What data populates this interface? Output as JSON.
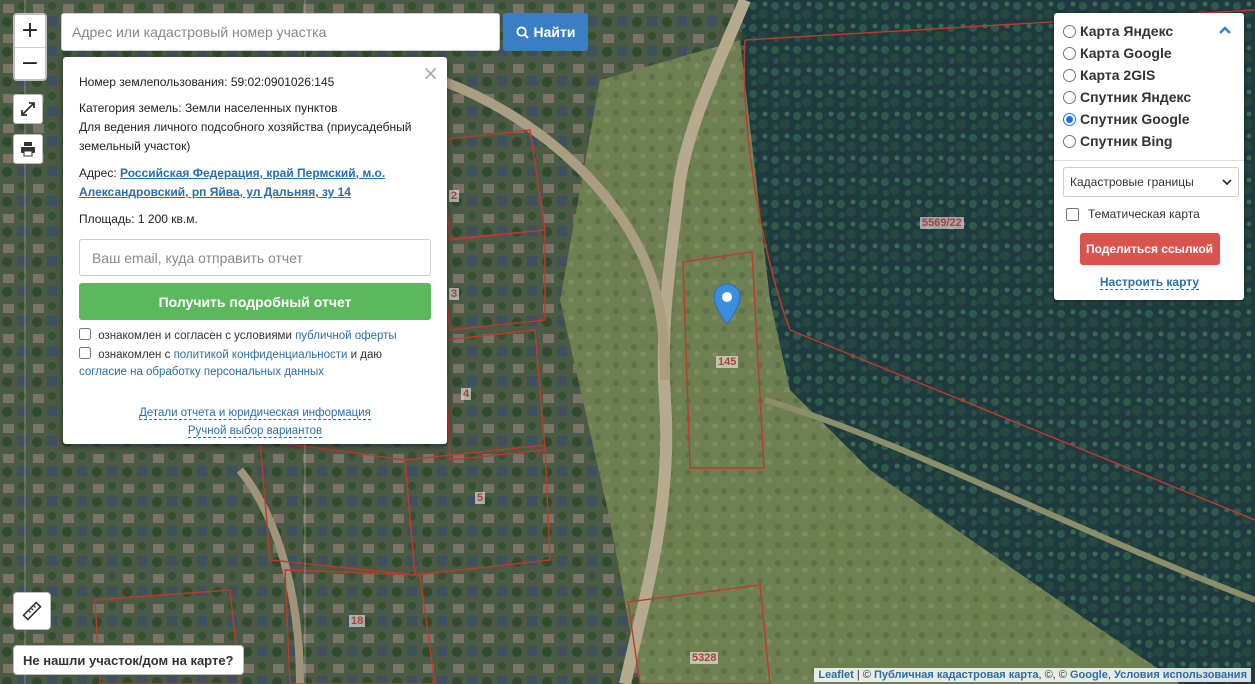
{
  "search": {
    "placeholder": "Адрес или кадастровый номер участка",
    "button_label": "Найти"
  },
  "zoom": {
    "in_label": "+",
    "out_label": "−"
  },
  "popup": {
    "land_use_label": "Номер землепользования:",
    "land_use_number": "59:02:0901026:145",
    "category_label": "Категория земель:",
    "category_value": "Земли населенных пунктов",
    "purpose": "Для ведения личного подсобного хозяйства (приусадебный земельный участок)",
    "address_label": "Адрес:",
    "address_value": "Российская Федерация, край Пермский, м.о. Александровский, рп Яйва, ул Дальняя, зу 14",
    "area_label": "Площадь:",
    "area_value": "1 200 кв.м.",
    "email_placeholder": "Ваш email, куда отправить отчет",
    "report_button": "Получить подробный отчет",
    "agree1_text": "ознакомлен и согласен с условиями ",
    "agree1_link": "публичной оферты",
    "agree2_text": "ознакомлен с ",
    "agree2_link1": "политикой конфиденциальности",
    "agree2_mid": " и даю ",
    "agree2_link2": "согласие на обработку персональных данных",
    "details_link": "Детали отчета и юридическая информация",
    "manual_link": "Ручной выбор вариантов"
  },
  "layers": {
    "options": [
      {
        "label": "Карта Яндекс",
        "selected": false
      },
      {
        "label": "Карта Google",
        "selected": false
      },
      {
        "label": "Карта 2GIS",
        "selected": false
      },
      {
        "label": "Спутник Яндекс",
        "selected": false
      },
      {
        "label": "Спутник Google",
        "selected": true
      },
      {
        "label": "Спутник Bing",
        "selected": false
      }
    ],
    "overlay_select": "Кадастровые границы",
    "thematic_label": "Тематическая карта",
    "share_button": "Поделиться ссылкой",
    "configure_link": "Настроить карту"
  },
  "map": {
    "parcel_labels": [
      "5569/22",
      "145",
      "5328",
      "2",
      "3",
      "4",
      "5",
      "18"
    ],
    "marker_color": "#3a8ee0"
  },
  "bottom": {
    "not_found_button": "Не нашли участок/дом на карте?"
  },
  "attribution": {
    "leaflet": "Leaflet",
    "sep1": " | © ",
    "pkk": "Публичная кадастровая карта",
    "sep2": ", ©, © ",
    "google": "Google",
    "sep3": ", ",
    "terms": "Условия использования"
  },
  "colors": {
    "accent_blue": "#3a7fc4",
    "report_green": "#5cb85c",
    "share_red": "#d9534f",
    "link_blue": "#2b6ea8",
    "parcel_red": "#c0392b"
  }
}
